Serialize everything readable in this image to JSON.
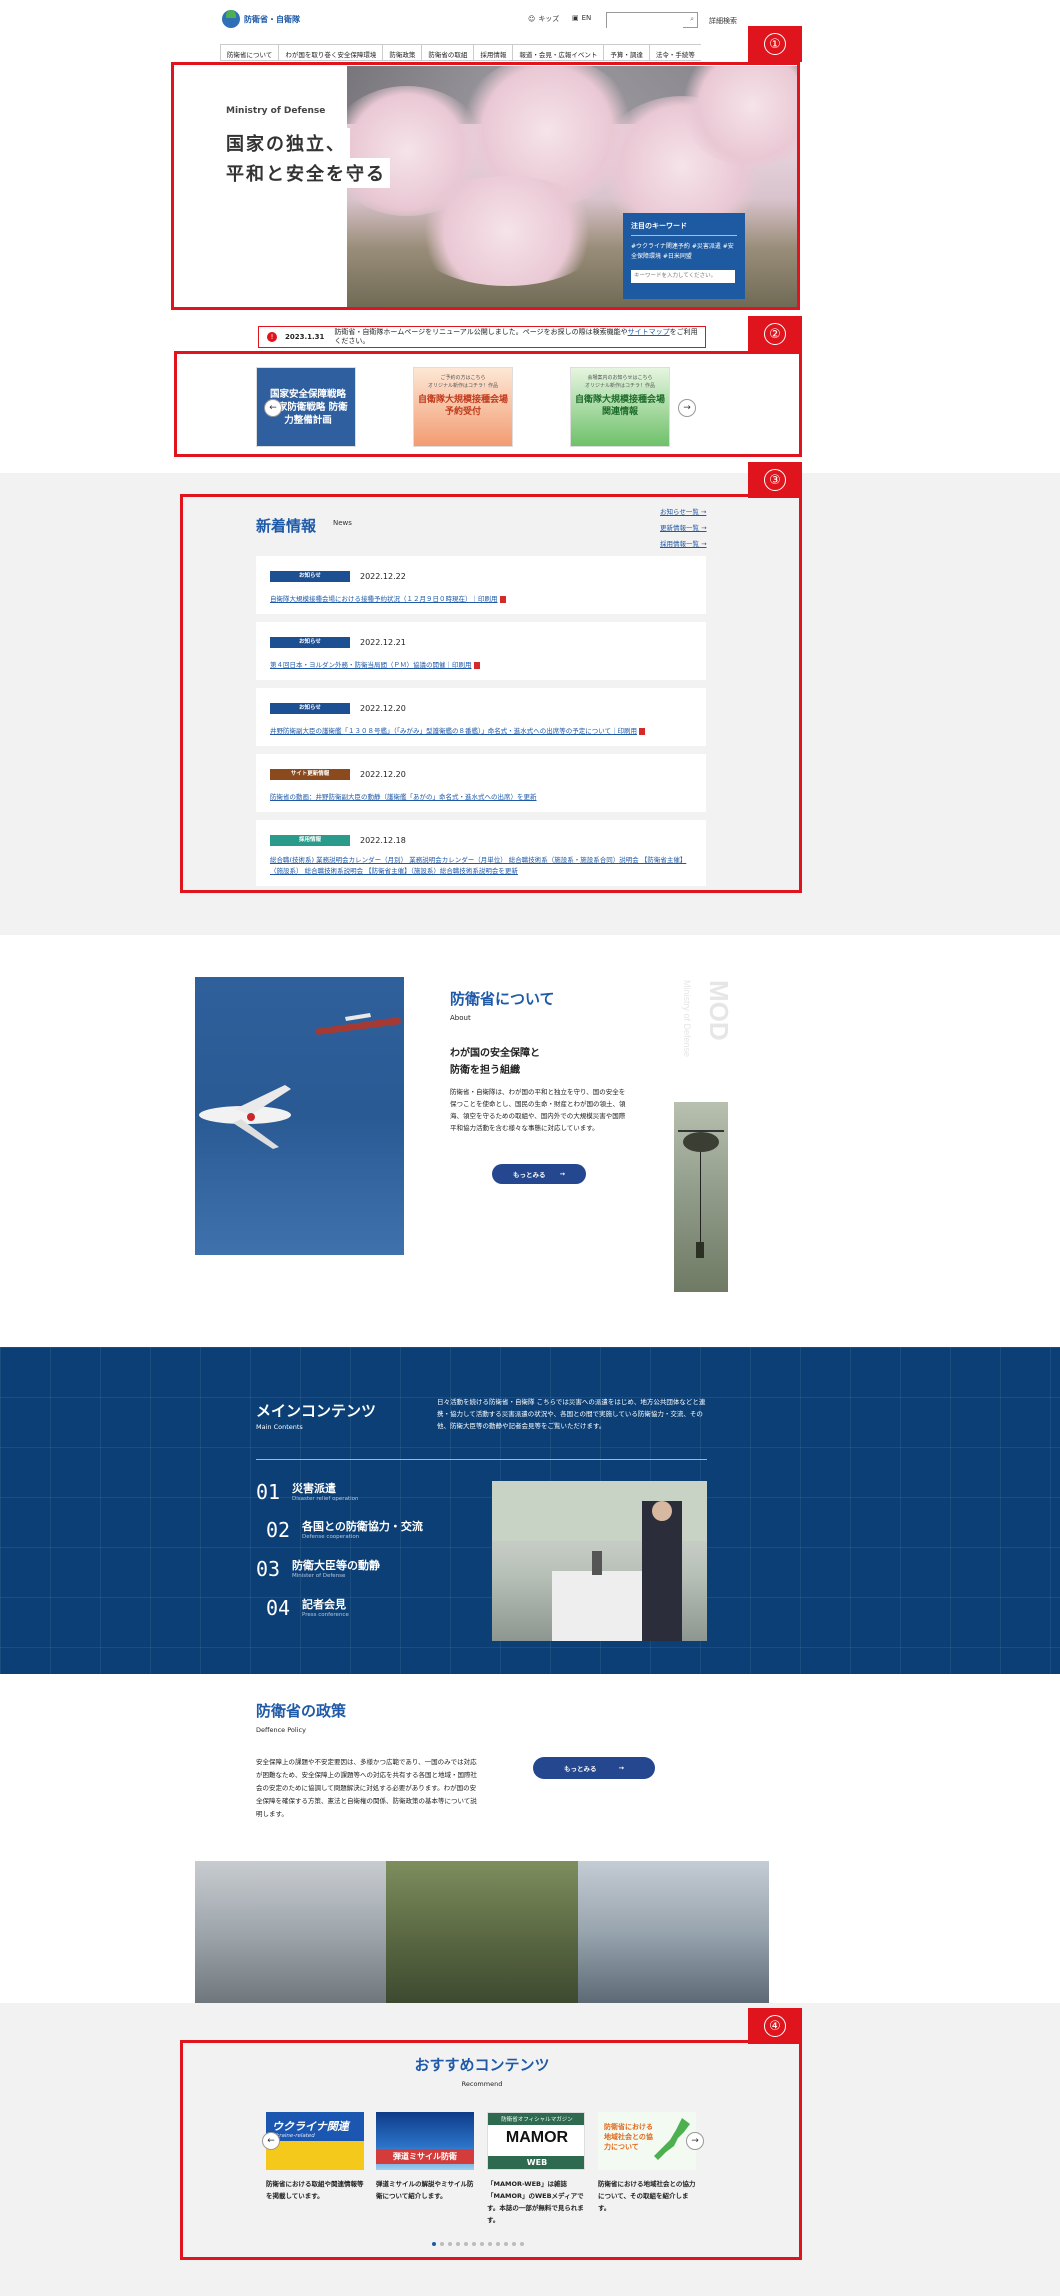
{
  "header": {
    "logo_text": "防衛省・自衛隊",
    "kids": "キッズ",
    "en": "EN",
    "search_placeholder": "",
    "search_icon": "search-icon",
    "advanced_search": "詳細検索"
  },
  "gnav": [
    "防衛省について",
    "わが国を取り巻く安全保障環境",
    "防衛政策",
    "防衛省の取組",
    "採用情報",
    "報道・会見・広報イベント",
    "予算・調達",
    "法令・手続等"
  ],
  "annotations": [
    "①",
    "②",
    "③",
    "④"
  ],
  "hero": {
    "en": "Ministry of Defense",
    "title_line1": "国家の独立、",
    "title_line2": "平和と安全を守る",
    "keyword_title": "注目のキーワード",
    "keywords": "#ウクライナ関連予約 #災害派遣 #安全保障環境 #日米同盟",
    "keyword_placeholder": "キーワードを入力してください。"
  },
  "notice": {
    "date": "2023.1.31",
    "text": "防衛省・自衛隊ホームページをリニューアル公開しました。ページをお探しの際は検索機能や",
    "link": "サイトマップ",
    "text_after": "をご利用ください。"
  },
  "banners": {
    "b1": "国家安全保障戦略 国家防衛戦略 防衛力整備計画",
    "b2_small": "ご予約の方はこちら",
    "b2_small2": "オリジナル新作はコチラ！作品",
    "b2_title": "自衛隊大規模接種会場 予約受付",
    "b3_small": "会場案内のお知らせはこちら",
    "b3_small2": "オリジナル新作はコチラ！作品",
    "b3_title": "自衛隊大規模接種会場 関連情報"
  },
  "news": {
    "title": "新着情報",
    "sub": "News",
    "links": [
      "お知らせ一覧 →",
      "更新情報一覧 →",
      "採用情報一覧 →"
    ],
    "items": [
      {
        "tag": "お知らせ",
        "tag_color": "#1d4f93",
        "date": "2022.12.22",
        "body": "自衛隊大規模接種会場における接種予約状況（１２月９日０時現在）｜印刷用"
      },
      {
        "tag": "お知らせ",
        "tag_color": "#1d4f93",
        "date": "2022.12.21",
        "body": "第４回日本・ヨルダン外務・防衛当局間（ＰＭ）協議の開催｜印刷用"
      },
      {
        "tag": "お知らせ",
        "tag_color": "#1d4f93",
        "date": "2022.12.20",
        "body": "井野防衛副大臣の護衛艦「１３０８号艦」（「みがみ」型護衛艦の８番艦）」命名式・進水式への出席等の予定について｜印刷用"
      },
      {
        "tag": "サイト更新情報",
        "tag_color": "#8a4a1d",
        "date": "2022.12.20",
        "body": "防衛省の動画：井野防衛副大臣の動静（護衛艦「あがの」命名式・進水式への出席）を更新"
      },
      {
        "tag": "採用情報",
        "tag_color": "#2a9a8a",
        "date": "2022.12.18",
        "body": "総合職(技術系) 業務説明会カレンダー（月別） 業務説明会カレンダー（月単位） 総合職技術系（施設系・施設系合同）説明会 【防衛省主催】（施設系） 総合職技術系説明会 【防衛省主催】（施設系）総合職技術系説明会を更新"
      }
    ]
  },
  "about": {
    "title": "防衛省について",
    "sub": "About",
    "heading1": "わが国の安全保障と",
    "heading2": "防衛を担う組織",
    "body": "防衛省・自衛隊は、わが国の平和と独立を守り、国の安全を保つことを使命とし、国民の生命・財産とわが国の領土、領海、領空を守るための取組や、国内外での大規模災害や国際平和協力活動を含む様々な事態に対応しています。",
    "more": "もっとみる",
    "vertical_big": "MOD",
    "vertical_small": "Ministry of Defense"
  },
  "main_contents": {
    "title": "メインコンテンツ",
    "sub": "Main Contents",
    "desc": "日々活動を続ける防衛省・自衛隊 こちらでは災害への派遣をはじめ、地方公共団体などと連携・協力して活動する災害派遣の状況や、各国との間で実施している防衛協力・交流、その他、防衛大臣等の動静や記者会見等をご覧いただけます。",
    "items": [
      {
        "num": "01",
        "label": "災害派遣",
        "en": "Disaster relief operation"
      },
      {
        "num": "02",
        "label": "各国との防衛協力・交流",
        "en": "Defense cooperation"
      },
      {
        "num": "03",
        "label": "防衛大臣等の動静",
        "en": "Minister of Defense"
      },
      {
        "num": "04",
        "label": "記者会見",
        "en": "Press conference"
      }
    ]
  },
  "policy": {
    "title": "防衛省の政策",
    "sub": "Deffence Policy",
    "body": "安全保障上の課題や不安定要因は、多様かつ広範であり、一国のみでは対応が困難なため、安全保障上の課題等への対応を共有する各国と地域・国際社会の安定のために協調して問題解決に対処する必要があります。わが国の安全保障を確保する方策、憲法と自衛権の関係、防衛政策の基本等について説明します。",
    "more": "もっとみる"
  },
  "recommend": {
    "title": "おすすめコンテンツ",
    "sub": "Recommend",
    "cards": [
      {
        "img_title": "ウクライナ関連",
        "img_sub": "Ukraine-related",
        "text": "防衛省における取組や関連情報等を掲載しています。"
      },
      {
        "img_title": "弾道ミサイル防衛",
        "img_sub": "",
        "text": "弾道ミサイルの解説やミサイル防衛について紹介します。"
      },
      {
        "img_title": "MAMOR",
        "img_sub": "防衛省オフィシャルマガジン",
        "img_sub2": "WEB",
        "text": "「MAMOR-WEB」は雑誌「MAMOR」のWEBメディアです。本誌の一部が無料で見られます。"
      },
      {
        "img_title": "防衛省における地域社会との協力について",
        "img_sub": "",
        "text": "防衛省における地域社会との協力について、その取組を紹介します。"
      }
    ]
  }
}
